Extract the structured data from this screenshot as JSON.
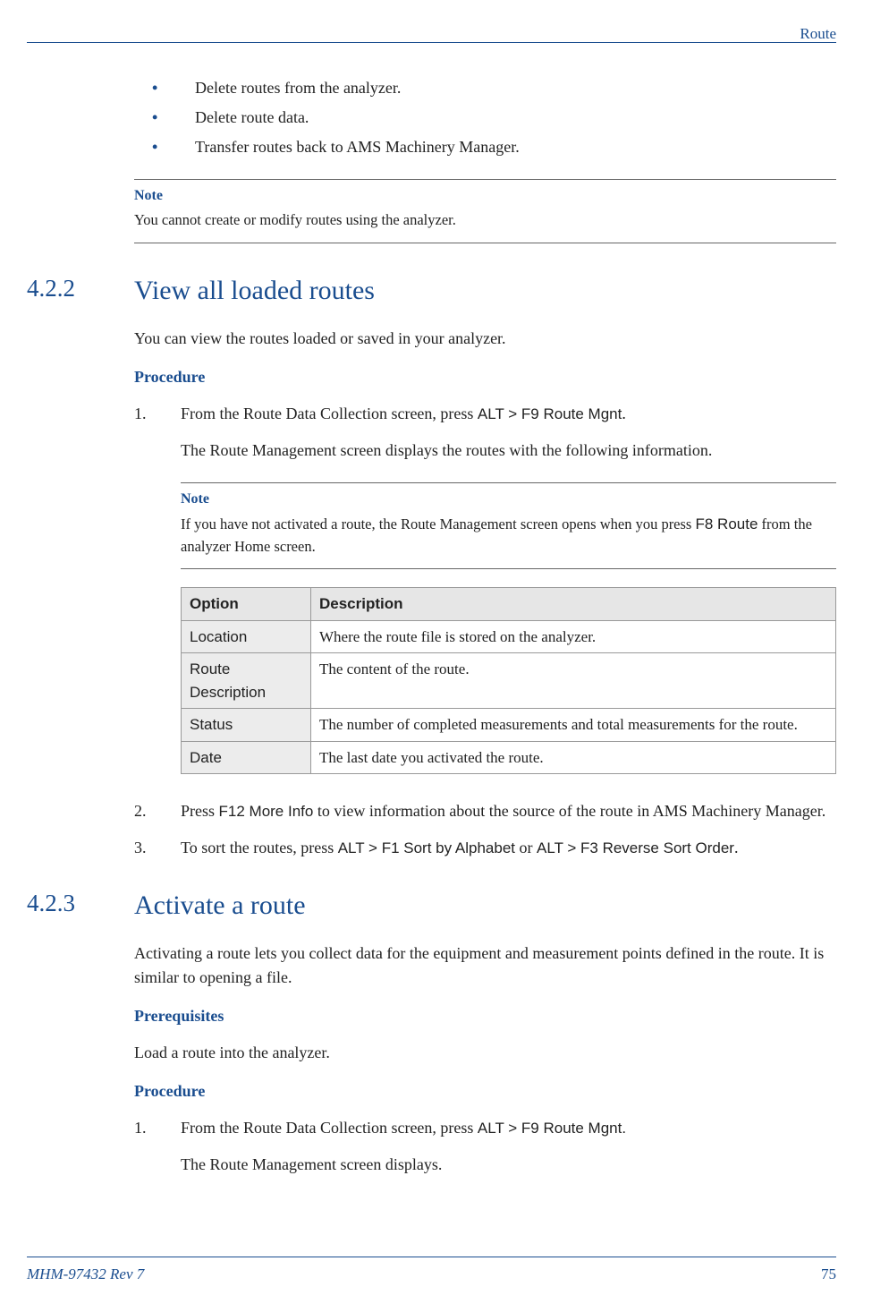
{
  "header": {
    "doc_section": "Route"
  },
  "bullets": [
    "Delete routes from the analyzer.",
    "Delete route data.",
    "Transfer routes back to AMS Machinery Manager."
  ],
  "note1": {
    "label": "Note",
    "text": "You cannot create or modify routes using the analyzer."
  },
  "sec422": {
    "num": "4.2.2",
    "title": "View all loaded routes",
    "intro": "You can view the routes loaded or saved in your analyzer.",
    "procedure_label": "Procedure",
    "step1": {
      "num": "1.",
      "pre": "From the Route Data Collection screen, press ",
      "cmd": "ALT > F9 Route Mgnt",
      "post": ".",
      "result": "The Route Management screen displays the routes with the following information."
    },
    "note": {
      "label": "Note",
      "pre": "If you have not activated a route, the Route Management screen opens when you press ",
      "cmd": "F8 Route",
      "post": " from the analyzer Home screen."
    },
    "table": {
      "headers": {
        "opt": "Option",
        "desc": "Description"
      },
      "rows": [
        {
          "opt": "Location",
          "desc": "Where the route file is stored on the analyzer."
        },
        {
          "opt": "Route Description",
          "desc": "The content of the route."
        },
        {
          "opt": "Status",
          "desc": "The number of completed measurements and total measurements for the route."
        },
        {
          "opt": "Date",
          "desc": "The last date you activated the route."
        }
      ]
    },
    "step2": {
      "num": "2.",
      "pre": "Press ",
      "cmd": "F12 More Info",
      "post": " to view information about the source of the route in AMS Machinery Manager."
    },
    "step3": {
      "num": "3.",
      "pre": "To sort the routes, press ",
      "cmd1": "ALT > F1 Sort by Alphabet",
      "mid": " or ",
      "cmd2": "ALT > F3 Reverse Sort Order",
      "post": "."
    }
  },
  "sec423": {
    "num": "4.2.3",
    "title": "Activate a route",
    "intro": "Activating a route lets you collect data for the equipment and measurement points defined in the route. It is similar to opening a file.",
    "prereq_label": "Prerequisites",
    "prereq_text": "Load a route into the analyzer.",
    "procedure_label": "Procedure",
    "step1": {
      "num": "1.",
      "pre": "From the Route Data Collection screen, press ",
      "cmd": "ALT > F9 Route Mgnt.",
      "result": "The Route Management screen displays."
    }
  },
  "footer": {
    "rev": "MHM-97432 Rev 7",
    "page": "75"
  }
}
